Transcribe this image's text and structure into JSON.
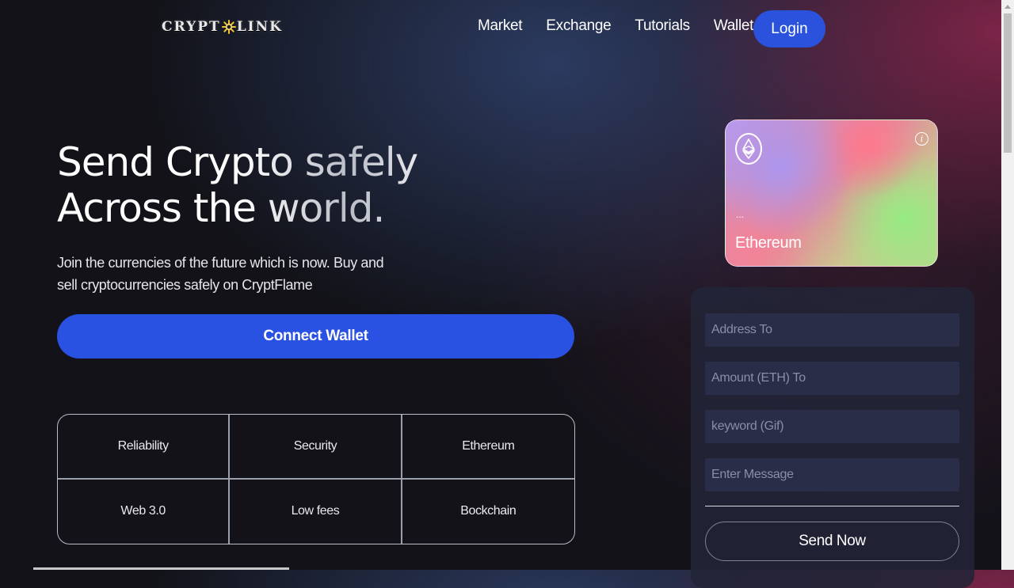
{
  "header": {
    "logo_text_left": "CRYPT",
    "logo_text_right": "LINK",
    "nav": [
      {
        "label": "Market"
      },
      {
        "label": "Exchange"
      },
      {
        "label": "Tutorials"
      },
      {
        "label": "Wallets"
      }
    ],
    "login_label": "Login"
  },
  "hero": {
    "title": "Send Crypto safely\nAcross the world.",
    "subtitle": "Join the currencies of the future which is now. Buy and sell cryptocurrencies safely on CryptFlame",
    "connect_label": "Connect Wallet"
  },
  "features": [
    "Reliability",
    "Security",
    "Ethereum",
    "Web 3.0",
    "Low fees",
    "Bockchain"
  ],
  "card": {
    "address": "...",
    "network": "Ethereum",
    "info_glyph": "i"
  },
  "form": {
    "address_placeholder": "Address To",
    "amount_placeholder": "Amount (ETH) To",
    "keyword_placeholder": "keyword (Gif)",
    "message_placeholder": "Enter Message",
    "send_label": "Send Now"
  },
  "colors": {
    "accent_blue": "#2952e3",
    "background": "#121218",
    "panel": "#222438"
  },
  "icons": {
    "logo_mark": "coin-burst-icon",
    "eth": "ethereum-icon",
    "info": "info-icon"
  }
}
